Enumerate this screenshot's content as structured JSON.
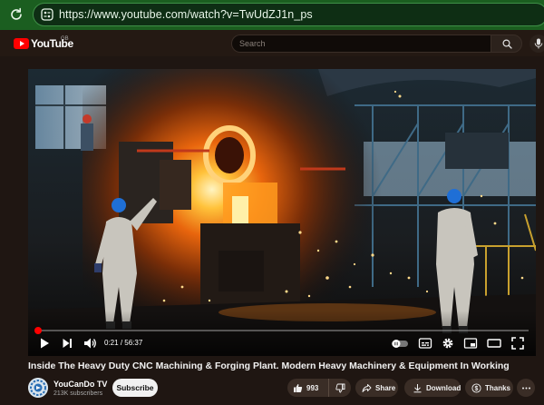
{
  "browser": {
    "url": "https://www.youtube.com/watch?v=TwUdZJ1n_ps"
  },
  "masthead": {
    "logo_text": "YouTube",
    "country_code": "GB",
    "search_placeholder": "Search"
  },
  "player": {
    "current_time": "0:21",
    "duration": "56:37",
    "progress_fraction": 0.0062
  },
  "video": {
    "title": "Inside The Heavy Duty CNC Machining & Forging Plant. Modern Heavy Machinery & Equipment In Working"
  },
  "channel": {
    "name": "YouCanDo TV",
    "subscribers": "213K subscribers",
    "subscribe_label": "Subscribe"
  },
  "actions": {
    "like_count": "993",
    "share_label": "Share",
    "download_label": "Download",
    "thanks_label": "Thanks"
  },
  "colors": {
    "browser_bar": "#1b5e20",
    "page_background": "#1f1612",
    "progress": "#ff0000",
    "subscribe_button": "#f1f1f1"
  },
  "icons": {
    "reload": "reload-icon",
    "site_info": "site-info-icon",
    "search": "search-icon",
    "mic": "microphone-icon",
    "play": "play-icon",
    "next": "next-icon",
    "volume": "volume-icon",
    "autoplay": "autoplay-toggle-icon",
    "subtitles": "subtitles-icon",
    "settings": "gear-icon",
    "miniplayer": "miniplayer-icon",
    "theater": "theater-mode-icon",
    "fullscreen": "fullscreen-icon",
    "like": "thumbs-up-icon",
    "dislike": "thumbs-down-icon",
    "share": "share-icon",
    "download": "download-icon",
    "thanks": "thanks-icon",
    "more": "more-icon"
  }
}
